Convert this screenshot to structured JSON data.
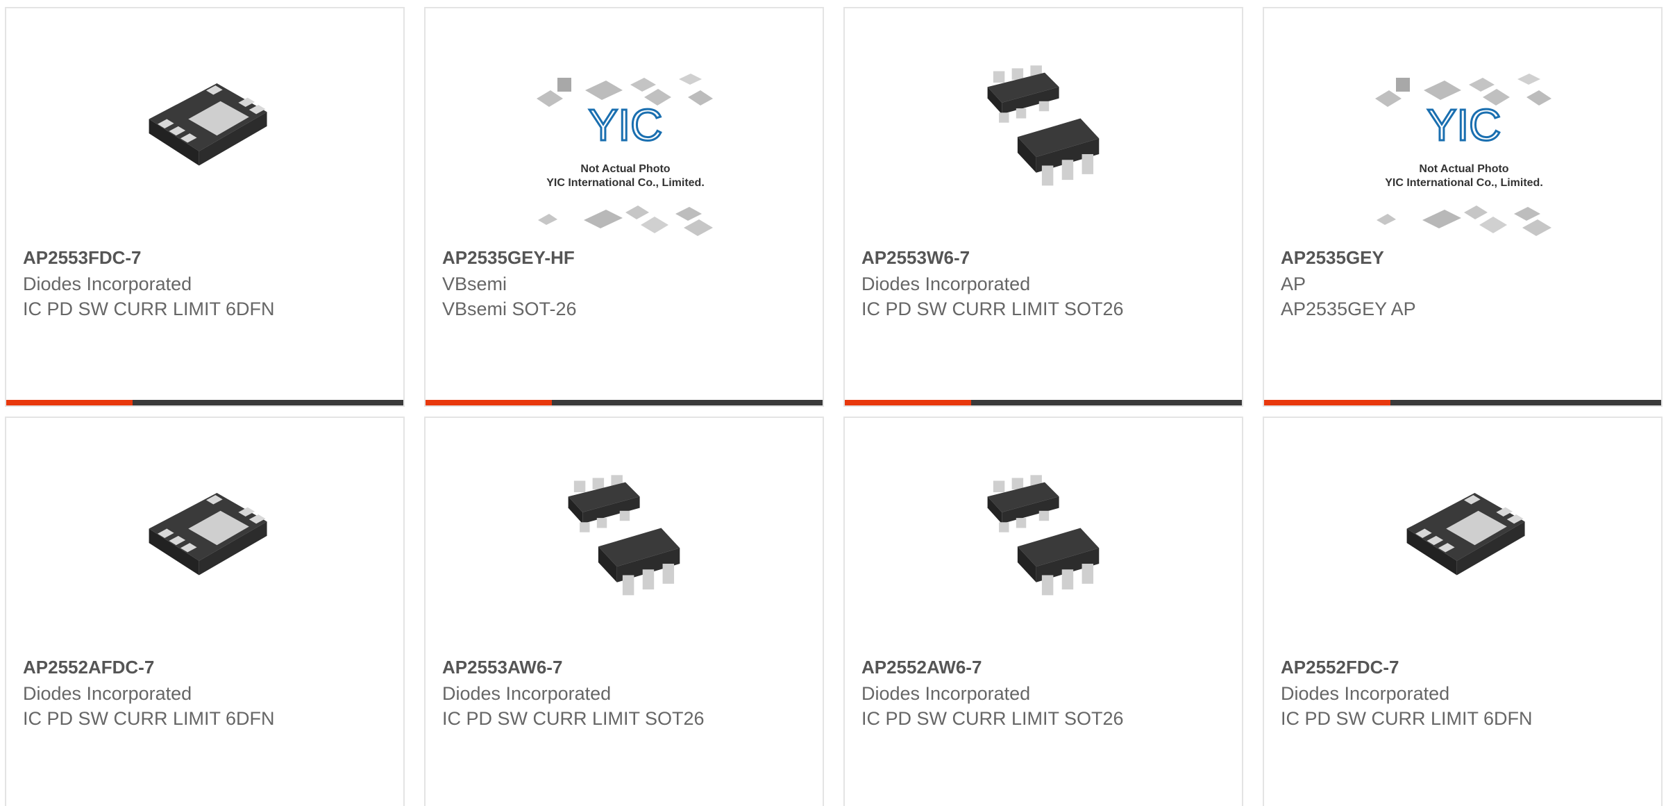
{
  "accent_color": "#e8380d",
  "bar_color": "#3a3a3a",
  "products": [
    {
      "part": "AP2553FDC-7",
      "manufacturer": "Diodes Incorporated",
      "description": "IC PD SW CURR LIMIT 6DFN",
      "image": "dfn-package-icon"
    },
    {
      "part": "AP2535GEY-HF",
      "manufacturer": "VBsemi",
      "description": "VBsemi SOT-26",
      "image": "placeholder-image",
      "placeholder_brand": "YIC",
      "placeholder_line1": "Not Actual Photo",
      "placeholder_line2": "YIC International Co., Limited."
    },
    {
      "part": "AP2553W6-7",
      "manufacturer": "Diodes Incorporated",
      "description": "IC PD SW CURR LIMIT SOT26",
      "image": "sot26-package-icon"
    },
    {
      "part": "AP2535GEY",
      "manufacturer": "AP",
      "description": "AP2535GEY AP",
      "image": "placeholder-image",
      "placeholder_brand": "YIC",
      "placeholder_line1": "Not Actual Photo",
      "placeholder_line2": "YIC International Co., Limited."
    },
    {
      "part": "AP2552AFDC-7",
      "manufacturer": "Diodes Incorporated",
      "description": "IC PD SW CURR LIMIT 6DFN",
      "image": "dfn-package-icon"
    },
    {
      "part": "AP2553AW6-7",
      "manufacturer": "Diodes Incorporated",
      "description": "IC PD SW CURR LIMIT SOT26",
      "image": "sot26-package-icon"
    },
    {
      "part": "AP2552AW6-7",
      "manufacturer": "Diodes Incorporated",
      "description": "IC PD SW CURR LIMIT SOT26",
      "image": "sot26-package-icon"
    },
    {
      "part": "AP2552FDC-7",
      "manufacturer": "Diodes Incorporated",
      "description": "IC PD SW CURR LIMIT 6DFN",
      "image": "dfn-package-icon"
    }
  ]
}
